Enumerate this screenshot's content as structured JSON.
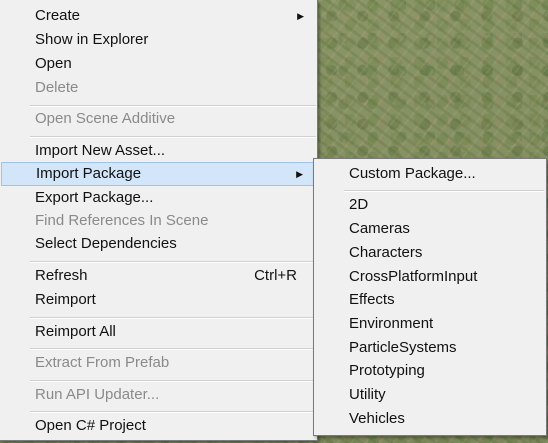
{
  "menu": {
    "items": [
      {
        "label": "Create",
        "has_submenu": true,
        "disabled": false
      },
      {
        "label": "Show in Explorer",
        "disabled": false
      },
      {
        "label": "Open",
        "disabled": false
      },
      {
        "label": "Delete",
        "disabled": true
      },
      {
        "label": "Open Scene Additive",
        "disabled": true
      },
      {
        "label": "Import New Asset...",
        "disabled": false
      },
      {
        "label": "Import Package",
        "has_submenu": true,
        "highlighted": true,
        "disabled": false
      },
      {
        "label": "Export Package...",
        "disabled": false
      },
      {
        "label": "Find References In Scene",
        "disabled": true
      },
      {
        "label": "Select Dependencies",
        "disabled": false
      },
      {
        "label": "Refresh",
        "shortcut": "Ctrl+R",
        "disabled": false
      },
      {
        "label": "Reimport",
        "disabled": false
      },
      {
        "label": "Reimport All",
        "disabled": false
      },
      {
        "label": "Extract From Prefab",
        "disabled": true
      },
      {
        "label": "Run API Updater...",
        "disabled": true
      },
      {
        "label": "Open C# Project",
        "disabled": false
      }
    ],
    "submenu_arrow": "▶"
  },
  "submenu": {
    "items": [
      {
        "label": "Custom Package..."
      },
      {
        "label": "2D"
      },
      {
        "label": "Cameras"
      },
      {
        "label": "Characters"
      },
      {
        "label": "CrossPlatformInput"
      },
      {
        "label": "Effects"
      },
      {
        "label": "Environment"
      },
      {
        "label": "ParticleSystems"
      },
      {
        "label": "Prototyping"
      },
      {
        "label": "Utility"
      },
      {
        "label": "Vehicles"
      }
    ]
  },
  "colors": {
    "menu_bg": "#f0f0f0",
    "highlight": "#d3e5f8",
    "disabled_text": "#8a8a8a"
  }
}
